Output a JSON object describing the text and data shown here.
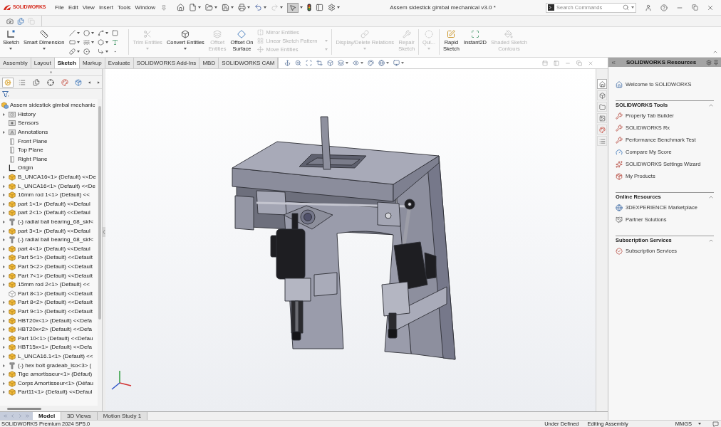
{
  "title_bar": {
    "app_name": "SOLIDWORKS",
    "menu": [
      "File",
      "Edit",
      "View",
      "Insert",
      "Tools",
      "Window"
    ],
    "quick_access": {
      "redo_disabled": true,
      "select_active": true
    },
    "document_title": "Assem sidestick gimbal mechanical v3.0 *",
    "search": {
      "placeholder": "Search Commands"
    }
  },
  "view_toolbar": [
    {
      "disabled": false
    },
    {
      "disabled": false
    },
    {
      "disabled": true
    }
  ],
  "command_manager": {
    "tools": [
      {
        "kind": "button",
        "label": "Sketch",
        "disabled": false,
        "menu": true
      },
      {
        "kind": "button",
        "label": "Smart Dimension",
        "disabled": false,
        "menu": true
      },
      {
        "kind": "entity_grid"
      },
      {
        "kind": "button",
        "label": "Trim Entities",
        "disabled": true,
        "menu": true
      },
      {
        "kind": "button",
        "label": "Convert Entities",
        "disabled": false,
        "menu": true
      },
      {
        "kind": "button",
        "label": "Offset\nEntities",
        "disabled": true,
        "menu": false
      },
      {
        "kind": "button",
        "label": "Offset On\nSurface",
        "disabled": false,
        "menu": false
      },
      {
        "kind": "stack",
        "items": [
          {
            "label": "Mirror Entities",
            "disabled": true,
            "menu": false
          },
          {
            "label": "Linear Sketch Pattern",
            "disabled": true,
            "menu": true
          },
          {
            "label": "Move Entities",
            "disabled": true,
            "menu": true
          }
        ]
      },
      {
        "kind": "button",
        "label": "Display/Delete Relations",
        "disabled": true,
        "menu": true
      },
      {
        "kind": "button",
        "label": "Repair\nSketch",
        "disabled": true,
        "menu": false
      },
      {
        "kind": "button",
        "label": "Qui...",
        "disabled": true,
        "menu": true
      },
      {
        "kind": "button",
        "label": "Rapid\nSketch",
        "disabled": false,
        "menu": false
      },
      {
        "kind": "button",
        "label": "Instant2D",
        "disabled": false,
        "menu": false
      },
      {
        "kind": "button",
        "label": "Shaded Sketch\nContours",
        "disabled": true,
        "menu": false
      }
    ]
  },
  "tabs": [
    {
      "label": "Assembly",
      "selected": false
    },
    {
      "label": "Layout",
      "selected": false
    },
    {
      "label": "Sketch",
      "selected": true
    },
    {
      "label": "Markup",
      "selected": false
    },
    {
      "label": "Evaluate",
      "selected": false
    },
    {
      "label": "SOLIDWORKS Add-Ins",
      "selected": false
    },
    {
      "label": "MBD",
      "selected": false
    },
    {
      "label": "SOLIDWORKS CAM",
      "selected": false
    }
  ],
  "feature_manager": {
    "panel_tabs": [
      {
        "selected": true
      },
      {
        "selected": false
      },
      {
        "selected": false
      },
      {
        "selected": false
      },
      {
        "selected": false
      },
      {
        "selected": false
      }
    ],
    "tree": {
      "label": "Assem sidestick gimbal mechanic",
      "children": [
        {
          "label": "History",
          "kind": "history",
          "expandable": true
        },
        {
          "label": "Sensors",
          "kind": "sensors",
          "expandable": false
        },
        {
          "label": "Annotations",
          "kind": "annotations",
          "expandable": true
        },
        {
          "label": "Front Plane",
          "kind": "plane",
          "expandable": false
        },
        {
          "label": "Top Plane",
          "kind": "plane",
          "expandable": false
        },
        {
          "label": "Right Plane",
          "kind": "plane",
          "expandable": false
        },
        {
          "label": "Origin",
          "kind": "origin",
          "expandable": false
        },
        {
          "label": "B_UNCA16<1> (Default) <<De",
          "kind": "part",
          "expandable": true
        },
        {
          "label": "L_UNCA16<1> (Default) <<De",
          "kind": "part",
          "expandable": true
        },
        {
          "label": "16mm rod 1<1> (Default) <<",
          "kind": "part",
          "expandable": true
        },
        {
          "label": "part 1<1> (Default) <<Defaul",
          "kind": "part",
          "expandable": true
        },
        {
          "label": "part 2<1> (Default) <<Defaul",
          "kind": "part",
          "expandable": true
        },
        {
          "label": "(-) radial ball bearing_68_skf<",
          "kind": "toolbox",
          "expandable": true
        },
        {
          "label": "part 3<1> (Default) <<Defaul",
          "kind": "part",
          "expandable": true
        },
        {
          "label": "(-) radial ball bearing_68_skf<",
          "kind": "toolbox",
          "expandable": true
        },
        {
          "label": "part 4<1> (Default) <<Defaul",
          "kind": "part",
          "expandable": true
        },
        {
          "label": "Part 5<1> (Default) <<Default",
          "kind": "part",
          "expandable": true
        },
        {
          "label": "Part 5<2> (Default) <<Default",
          "kind": "part",
          "expandable": true
        },
        {
          "label": "Part 7<1> (Default) <<Default",
          "kind": "part",
          "expandable": true
        },
        {
          "label": "15mm rod 2<1> (Default) <<",
          "kind": "part",
          "expandable": true
        },
        {
          "label": "Part 8<1> (Default) <<Default",
          "kind": "part_outline",
          "expandable": false
        },
        {
          "label": "Part 8<2> (Default) <<Default",
          "kind": "part",
          "expandable": true
        },
        {
          "label": "Part 9<1> (Default) <<Default",
          "kind": "part",
          "expandable": true
        },
        {
          "label": "HBT20x<1> (Default) <<Defa",
          "kind": "part",
          "expandable": true
        },
        {
          "label": "HBT20x<2> (Default) <<Defa",
          "kind": "part",
          "expandable": true
        },
        {
          "label": "Part 10<1> (Default) <<Defau",
          "kind": "part",
          "expandable": true
        },
        {
          "label": "HBT15x<1> (Default) <<Defa",
          "kind": "part",
          "expandable": true
        },
        {
          "label": "L_UNCA16.1<1> (Default) <<",
          "kind": "part",
          "expandable": true
        },
        {
          "label": "(-) hex bolt gradeab_iso<3> (",
          "kind": "toolbox",
          "expandable": true
        },
        {
          "label": "Tige amortisseur<1> (Défaut)",
          "kind": "part",
          "expandable": true
        },
        {
          "label": "Corps Amortisseur<1> (Défau",
          "kind": "part",
          "expandable": true
        },
        {
          "label": "Part11<1> (Default) <<Defaul",
          "kind": "part",
          "expandable": true
        }
      ]
    }
  },
  "bottom_tabs": [
    {
      "label": "Model",
      "selected": true
    },
    {
      "label": "3D Views",
      "selected": false
    },
    {
      "label": "Motion Study 1",
      "selected": false
    }
  ],
  "task_pane": {
    "side_tabs": [
      {
        "selected": true
      },
      {
        "selected": false
      },
      {
        "selected": false
      },
      {
        "selected": false
      },
      {
        "selected": false
      },
      {
        "selected": false
      }
    ],
    "title": "SOLIDWORKS Resources",
    "welcome": "Welcome to SOLIDWORKS",
    "sections": [
      {
        "title": "SOLIDWORKS Tools",
        "expanded": true,
        "items": [
          {
            "label": "Property Tab Builder",
            "kind": "tool"
          },
          {
            "label": "SOLIDWORKS Rx",
            "kind": "tool"
          },
          {
            "label": "Performance Benchmark Test",
            "kind": "tool"
          },
          {
            "label": "Compare My Score",
            "kind": "score"
          },
          {
            "label": "SOLIDWORKS Settings Wizard",
            "kind": "wizard"
          },
          {
            "label": "My Products",
            "kind": "products"
          }
        ]
      },
      {
        "title": "Online Resources",
        "expanded": true,
        "items": [
          {
            "label": "3DEXPERIENCE Marketplace",
            "kind": "globe"
          },
          {
            "label": "Partner Solutions",
            "kind": "handshake"
          }
        ]
      },
      {
        "title": "Subscription Services",
        "expanded": true,
        "items": [
          {
            "label": "Subscription Services",
            "kind": "subscription"
          }
        ]
      }
    ]
  },
  "status_bar": {
    "product": "SOLIDWORKS Premium 2024 SP5.0",
    "sketch_state": "Under Defined",
    "mode": "Editing Assembly",
    "units": "MMGS"
  }
}
